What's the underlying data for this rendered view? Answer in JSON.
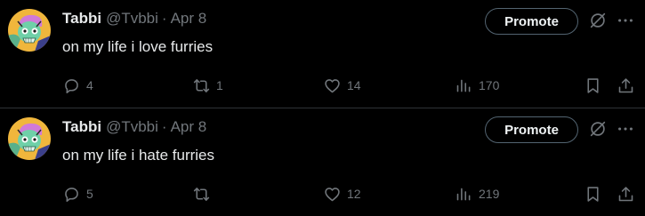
{
  "tweets": [
    {
      "name": "Tabbi",
      "handle": "@Tvbbi",
      "separator": "·",
      "date": "Apr 8",
      "text": "on my life i love furries",
      "promote_label": "Promote",
      "replies": "4",
      "retweets": "1",
      "likes": "14",
      "views": "170"
    },
    {
      "name": "Tabbi",
      "handle": "@Tvbbi",
      "separator": "·",
      "date": "Apr 8",
      "text": "on my life i hate furries",
      "promote_label": "Promote",
      "replies": "5",
      "retweets": "",
      "likes": "12",
      "views": "219"
    }
  ],
  "icons": {
    "avatar": "avatar-cartoon",
    "grok": "grok-icon",
    "more": "more-icon",
    "reply": "reply-icon",
    "retweet": "retweet-icon",
    "like": "heart-icon",
    "views": "views-icon",
    "bookmark": "bookmark-icon",
    "share": "share-icon"
  },
  "colors": {
    "background": "#000000",
    "primary_text": "#e7e9ea",
    "secondary_text": "#71767b",
    "divider": "#2f3336",
    "avatar_bg": "#f0b63c",
    "avatar_hair": "#d07ad8",
    "avatar_face": "#6fd0a8"
  }
}
